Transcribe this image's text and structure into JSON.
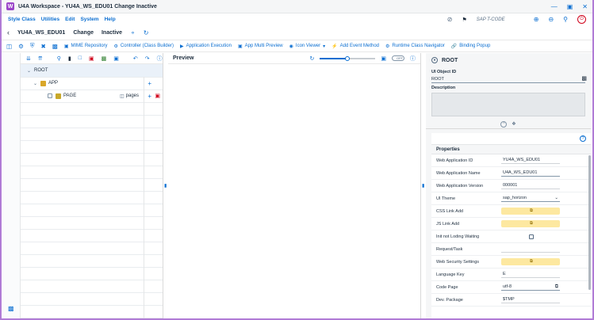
{
  "window": {
    "title": "U4A Workspace - YU4A_WS_EDU01 Change Inactive",
    "logo": "W"
  },
  "menu": {
    "items": [
      "Style Class",
      "Utilities",
      "Edit",
      "System",
      "Help"
    ],
    "tcode_placeholder": "SAP T-CODE"
  },
  "header": {
    "app_id": "YU4A_WS_EDU01",
    "mode": "Change",
    "status": "Inactive"
  },
  "toolbar": {
    "buttons": [
      "MIME Repository",
      "Controller (Class Builder)",
      "Application Execution",
      "App Multi Preview",
      "Icon Viewer",
      "Add Event Method",
      "Runtime Class Navigator",
      "Binding Popup"
    ]
  },
  "tree": {
    "root": "ROOT",
    "app": "APP",
    "page": "PAGE",
    "page_agg": "pages"
  },
  "preview": {
    "title": "Preview",
    "zoom": 0.5,
    "switch": "OFF"
  },
  "props": {
    "node": "ROOT",
    "ui_object_label": "UI Object ID",
    "ui_object_value": "ROOT",
    "description_label": "Description",
    "section_title": "Properties",
    "rows": [
      {
        "key": "Web Application ID",
        "value": "YU4A_WS_EDU01",
        "kind": "plain"
      },
      {
        "key": "Web Application Name",
        "value": "U4A_WS_EDU01",
        "kind": "input"
      },
      {
        "key": "Web Application Version",
        "value": "000001",
        "kind": "plain"
      },
      {
        "key": "UI Theme",
        "value": "sap_horizon",
        "kind": "select"
      },
      {
        "key": "CSS Link Add",
        "value": "",
        "kind": "yellow"
      },
      {
        "key": "JS Link Add",
        "value": "",
        "kind": "yellow"
      },
      {
        "key": "Init not Loding Waiting",
        "value": "",
        "kind": "check"
      },
      {
        "key": "Request/Task",
        "value": "",
        "kind": "plain"
      },
      {
        "key": "Web Security Settings",
        "value": "",
        "kind": "yellow"
      },
      {
        "key": "Language Key",
        "value": "E",
        "kind": "plain"
      },
      {
        "key": "Code Page",
        "value": "utf-8",
        "kind": "copy"
      },
      {
        "key": "Dev. Package",
        "value": "$TMP",
        "kind": "plain"
      }
    ]
  }
}
